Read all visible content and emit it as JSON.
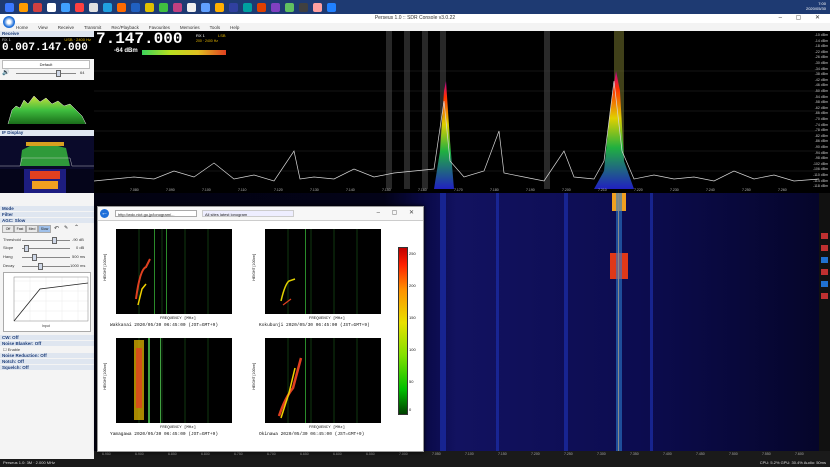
{
  "window": {
    "title": "Perseus 1.0 :: SDR Console v3.0.22",
    "controls": "–  ▢  ✕"
  },
  "taskbar": {
    "time": "7:00",
    "date": "2020/05/30",
    "icon_colors": [
      "#3b78ff",
      "#ff9c00",
      "#d04040",
      "#ffffff",
      "#40a0ff",
      "#ff4040",
      "#e0e0e0",
      "#20a0e0",
      "#ff6a00",
      "#2060c0",
      "#e0c000",
      "#40c040",
      "#c04080",
      "#f0f0f0",
      "#60a0ff",
      "#ffb000",
      "#3040a0",
      "#00a0a0",
      "#e04000",
      "#8040c0",
      "#60c060",
      "#404040",
      "#ffa0a0",
      "#2080ff"
    ]
  },
  "menu": {
    "items": [
      "Home",
      "View",
      "Receive",
      "Transmit",
      "Rec/Playback",
      "Favourites",
      "Memories",
      "Tools",
      "Help"
    ]
  },
  "left_panel": {
    "receive_header": "Receive",
    "rx_label": "RX 1",
    "mode_label": "USB · 2400 Hz",
    "frequency": "0.007.147.000",
    "preset": "Default",
    "volume_value": "64",
    "if_display_header": "IF Display",
    "mode_header": "Mode",
    "filter_header": "Filter",
    "agc_header": "AGC: Slow",
    "agc_buttons": [
      "Off",
      "Fast",
      "Med",
      "Slow"
    ],
    "agc_active": "Slow",
    "threshold_label": "Threshold",
    "threshold_value": "-90 dB",
    "slope_label": "Slope",
    "slope_value": "0 dB",
    "hang_label": "Hang",
    "hang_value": "500 ms",
    "decay_label": "Decay",
    "decay_value": "1000 ms",
    "agc_graph_xlabel": "Input",
    "cw_header": "CW: Off",
    "noise_blanker_header": "Noise Blanker: Off",
    "enable_label": "Enable",
    "noise_reduction_header": "Noise Reduction: Off",
    "notch_header": "Notch: Off",
    "squelch_header": "Squelch: Off"
  },
  "smeter": {
    "frequency": "7.147.000",
    "dbm": "-64 dBm",
    "rx_label": "RX 1",
    "mode": "LSB",
    "bandwidth": "200 · 2400 Hz",
    "scale": [
      "-127",
      "-115",
      "-103",
      "-91",
      "-79",
      "-67",
      "-55",
      "-43"
    ]
  },
  "panorama": {
    "db_labels": [
      "-10 dBm",
      "-14 dBm",
      "-18 dBm",
      "-22 dBm",
      "-26 dBm",
      "-30 dBm",
      "-34 dBm",
      "-38 dBm",
      "-42 dBm",
      "-46 dBm",
      "-50 dBm",
      "-54 dBm",
      "-58 dBm",
      "-62 dBm",
      "-66 dBm",
      "-70 dBm",
      "-74 dBm",
      "-78 dBm",
      "-82 dBm",
      "-86 dBm",
      "-90 dBm",
      "-94 dBm",
      "-98 dBm",
      "-102 dBm",
      "-106 dBm",
      "-110 dBm",
      "-114 dBm",
      "-118 dBm"
    ],
    "freq_labels_top": [
      "7.080",
      "7.090",
      "7.100",
      "7.110",
      "7.120",
      "7.130",
      "7.140",
      "7.150",
      "7.160",
      "7.170",
      "7.180",
      "7.190",
      "7.200",
      "7.210",
      "7.220",
      "7.230",
      "7.240",
      "7.250",
      "7.260"
    ],
    "freq_labels_bottom": [
      "6.950",
      "6.900",
      "6.850",
      "6.800",
      "6.750",
      "6.700",
      "6.650",
      "6.600",
      "6.550",
      "7.000",
      "7.050",
      "7.100",
      "7.150",
      "7.200",
      "7.250",
      "7.300",
      "7.350",
      "7.400",
      "7.450",
      "7.500",
      "7.550",
      "7.600"
    ]
  },
  "statusbar": {
    "left": "Perseus 1.0: 3M · 2.000 MHz",
    "right": "CPU: 5.2%     GPU: 30.4%     Audio: 50ms"
  },
  "browser": {
    "url": "http://wdc.nict.go.jp/ionogram/...",
    "tab_title": "All sites latest ionogram",
    "window_controls": "–  ▢  ✕",
    "ionograms": [
      {
        "caption": "Wakkanai 2020/05/30 06:45:00 (JST=GMT+9)",
        "x_label": "FREQUENCY [MHz]",
        "y_label": "HEIGHT [100km]"
      },
      {
        "caption": "Kokubunji 2020/05/30 06:45:00 (JST=GMT+9)",
        "x_label": "FREQUENCY [MHz]",
        "y_label": "HEIGHT [100km]"
      },
      {
        "caption": "Yamagawa 2020/05/30 06:45:00 (JST=GMT+9)",
        "x_label": "FREQUENCY [MHz]",
        "y_label": "HEIGHT [100km]"
      },
      {
        "caption": "Okinawa 2020/05/30 06:45:00 (JST=GMT+9)",
        "x_label": "FREQUENCY [MHz]",
        "y_label": "HEIGHT [100km]"
      }
    ],
    "ionogram_x_ticks": [
      "0",
      "5",
      "10",
      "15",
      "20",
      "25",
      "30"
    ],
    "ionogram_y_ticks": [
      "10",
      "8",
      "6",
      "4",
      "2",
      "0"
    ],
    "colorscale_labels": [
      "250",
      "200",
      "150",
      "100",
      "50",
      "0"
    ]
  }
}
